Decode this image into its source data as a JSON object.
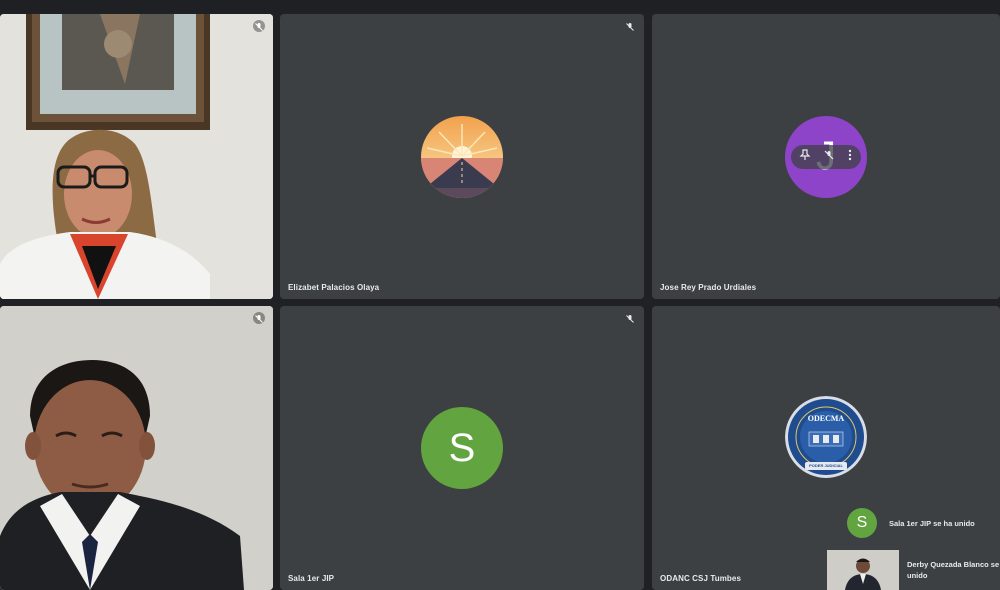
{
  "participants": [
    {
      "name": "",
      "type": "video"
    },
    {
      "name": "Elizabet Palacios Olaya",
      "type": "avatar-image"
    },
    {
      "name": "Jose Rey Prado Urdiales",
      "type": "avatar-letter",
      "initial": "J",
      "color": "#8e44c9"
    },
    {
      "name": "",
      "type": "video"
    },
    {
      "name": "Sala 1er JIP",
      "type": "avatar-letter",
      "initial": "S",
      "color": "#62a43f"
    },
    {
      "name": "ODANC CSJ Tumbes",
      "type": "avatar-image",
      "logo_text": "ODECMA",
      "logo_sub": "PODER JUDICIAL"
    }
  ],
  "notifications": [
    {
      "avatar_initial": "S",
      "text": "Sala 1er JIP se ha unido"
    },
    {
      "text_line1": "Derby Quezada Blanco se h",
      "text_line2": "unido"
    }
  ],
  "icons": {
    "mic_off": "mic-off-icon",
    "pin": "pin-icon",
    "more": "more-vert-icon"
  }
}
